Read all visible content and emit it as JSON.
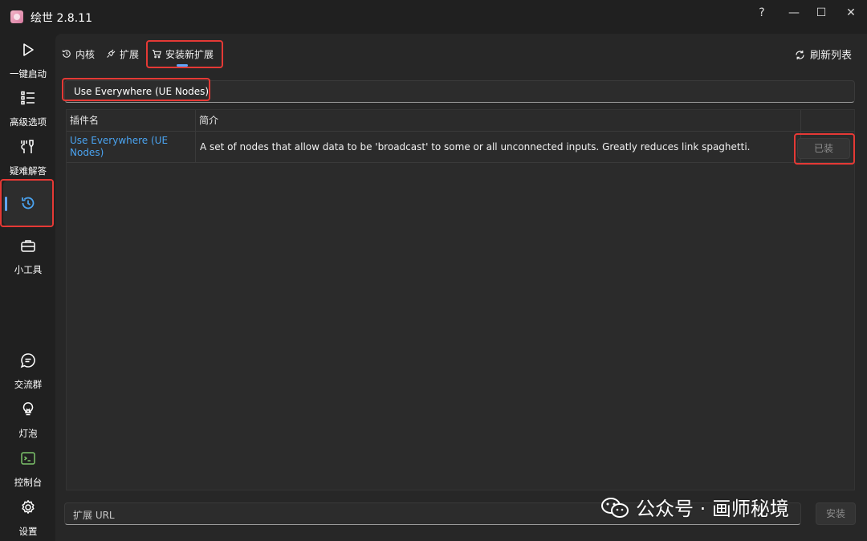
{
  "window": {
    "title": "绘世 2.8.11",
    "controls": {
      "help": "?",
      "minimize": "—",
      "maximize": "☐",
      "close": "✕"
    }
  },
  "sidebar": {
    "items": [
      {
        "label": "一键启动",
        "icon": "play-icon"
      },
      {
        "label": "高级选项",
        "icon": "list-icon"
      },
      {
        "label": "疑难解答",
        "icon": "wrench-icon"
      },
      {
        "label": "",
        "icon": "history-icon",
        "active": true
      },
      {
        "label": "小工具",
        "icon": "toolbox-icon"
      },
      {
        "label": "交流群",
        "icon": "chat-icon"
      },
      {
        "label": "灯泡",
        "icon": "lightbulb-icon"
      },
      {
        "label": "控制台",
        "icon": "console-icon"
      },
      {
        "label": "设置",
        "icon": "gear-icon"
      }
    ]
  },
  "tabs": [
    {
      "label": "内核",
      "icon": "history-icon"
    },
    {
      "label": "扩展",
      "icon": "plug-icon"
    },
    {
      "label": "安装新扩展",
      "icon": "cart-icon",
      "selected": true
    }
  ],
  "toolbar": {
    "refresh_label": "刷新列表"
  },
  "search": {
    "value": "Use Everywhere (UE Nodes)"
  },
  "table": {
    "headers": [
      "插件名",
      "简介"
    ],
    "rows": [
      {
        "name": "Use Everywhere (UE Nodes)",
        "description": "A set of nodes that allow data to be 'broadcast' to some or all unconnected inputs. Greatly reduces link spaghetti.",
        "action": "已装"
      }
    ]
  },
  "url_install": {
    "placeholder": "扩展 URL",
    "button": "安装"
  },
  "watermark": {
    "text": "公众号 · 画师秘境"
  },
  "colors": {
    "accent": "#60a5fa",
    "link": "#4aa3f0",
    "highlight": "#e53935",
    "console_icon": "#7cc36a"
  }
}
